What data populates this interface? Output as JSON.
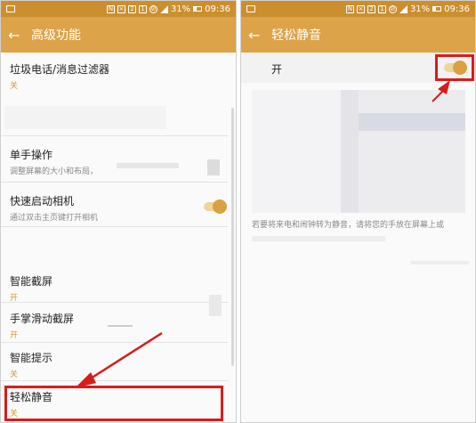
{
  "status_bar": {
    "battery": "31%",
    "time": "09:36"
  },
  "left_screen": {
    "title": "高级功能",
    "items": [
      {
        "title": "垃圾电话/消息过滤器",
        "subtitle": "关"
      },
      {
        "title": "单手操作",
        "subtitle": "调整屏幕的大小和布局，"
      },
      {
        "title": "快速启动相机",
        "subtitle": "通过双击主页键打开相机"
      },
      {
        "title": "智能截屏",
        "subtitle": "开"
      },
      {
        "title": "手掌滑动截屏",
        "subtitle": "开"
      },
      {
        "title": "智能提示",
        "subtitle": "关"
      },
      {
        "title": "轻松静音",
        "subtitle": "关"
      }
    ]
  },
  "right_screen": {
    "title": "轻松静音",
    "on_label": "开",
    "description": "若要将来电和闹钟转为静音，请将您的手放在屏幕上或"
  },
  "colors": {
    "app_bar": "#dca349",
    "accent": "#d9962b",
    "highlight": "#d81c1c"
  }
}
